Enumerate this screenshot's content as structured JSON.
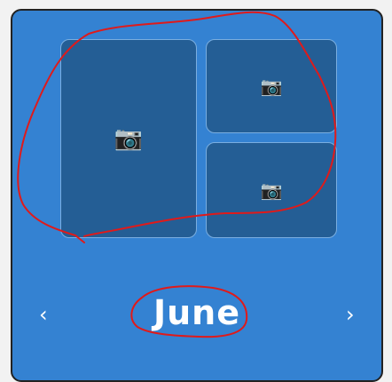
{
  "calendar": {
    "month_label": "June",
    "prev_glyph": "‹",
    "next_glyph": "›"
  },
  "photo_tiles": [
    {
      "icon": "camera-icon",
      "glyph": "📷"
    },
    {
      "icon": "camera-icon",
      "glyph": "📷"
    },
    {
      "icon": "camera-icon",
      "glyph": "📷"
    }
  ],
  "colors": {
    "panel": "#3482d2",
    "tile": "#245e95",
    "tile_border": "#7aaee0",
    "annotation": "#e01a1a"
  }
}
